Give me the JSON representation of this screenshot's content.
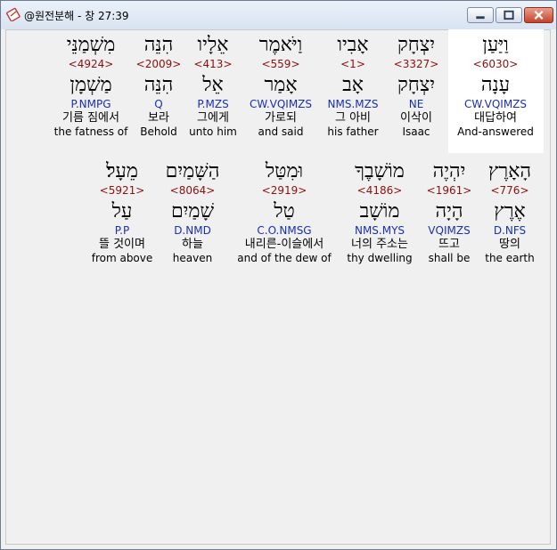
{
  "window": {
    "title": "@원전분해 - 창 27:39",
    "icons": {
      "app": "bible-app-icon",
      "minimize": "minimize-icon",
      "maximize": "maximize-icon",
      "close": "close-icon"
    }
  },
  "rows": [
    [
      {
        "heb": "וַיַּעַן",
        "strong": "<6030>",
        "lemma": "עָנָה",
        "parse": "CW.VQIMZS",
        "ko": "대답하여",
        "en": "And-answered"
      },
      {
        "heb": "יִצְחָק",
        "strong": "<3327>",
        "lemma": "יִצְחָק",
        "parse": "NE",
        "ko": "이삭이",
        "en": "Isaac"
      },
      {
        "heb": "אָבִיו",
        "strong": "<1>",
        "lemma": "אָב",
        "parse": "NMS.MZS",
        "ko": "그 아비",
        "en": "his father"
      },
      {
        "heb": "וַיֹּאמֶר",
        "strong": "<559>",
        "lemma": "אָמַר",
        "parse": "CW.VQIMZS",
        "ko": "가로되",
        "en": "and said"
      },
      {
        "heb": "אֵלָיו",
        "strong": "<413>",
        "lemma": "אֵל",
        "parse": "P.MZS",
        "ko": "그에게",
        "en": "unto him"
      },
      {
        "heb": "הִנֵּה",
        "strong": "<2009>",
        "lemma": "הִנֵּה",
        "parse": "Q",
        "ko": "보라",
        "en": "Behold"
      },
      {
        "heb": "מִשְׁמַנֵּי",
        "strong": "<4924>",
        "lemma": "מַשְׁמָן",
        "parse": "P.NMPG",
        "ko": "기름 짐에서",
        "en": "the fatness of"
      }
    ],
    [
      {
        "heb": "הָאָרֶץ",
        "strong": "<776>",
        "lemma": "אֶרֶץ",
        "parse": "D.NFS",
        "ko": "땅의",
        "en": "the earth"
      },
      {
        "heb": "יִהְיֶה",
        "strong": "<1961>",
        "lemma": "הָיָה",
        "parse": "VQIMZS",
        "ko": "뜨고",
        "en": "shall be"
      },
      {
        "heb": "מוֹשָׁבֶךָ",
        "strong": "<4186>",
        "lemma": "מוֹשָׁב",
        "parse": "NMS.MYS",
        "ko": "너의 주소는",
        "en": "thy dwelling"
      },
      {
        "heb": "וּמִטַּל",
        "strong": "<2919>",
        "lemma": "טַל",
        "parse": "C.O.NMSG",
        "ko": "내리른-이슬에서",
        "en": "and of the dew of"
      },
      {
        "heb": "הַשָּׁמַיִם",
        "strong": "<8064>",
        "lemma": "שָׁמַיִם",
        "parse": "D.NMD",
        "ko": "하늘",
        "en": "heaven"
      },
      {
        "heb": "מֵעָל׃",
        "strong": "<5921>",
        "lemma": "עַל",
        "parse": "P.P",
        "ko": "뜰 것이며",
        "en": "from above"
      }
    ]
  ]
}
